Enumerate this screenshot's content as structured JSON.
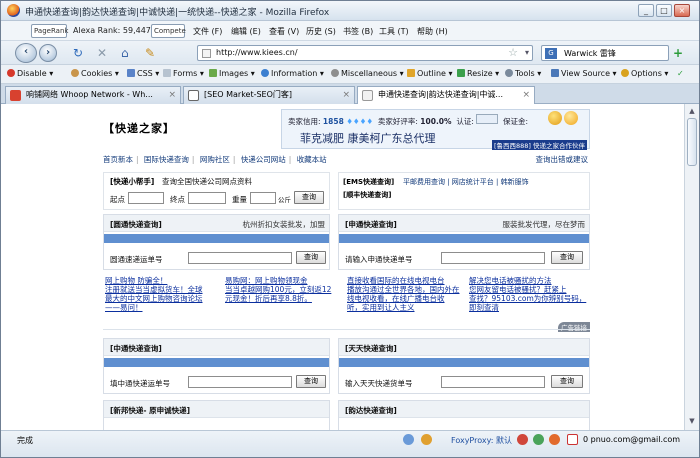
{
  "window": {
    "title": "申通快递查询|韵达快递查询|中诚快递|一统快递--快递之家 - Mozilla Firefox",
    "buttons": [
      "_",
      "□",
      "×"
    ]
  },
  "menubar": {
    "pagerank_label": "PageRank",
    "alexa": "Alexa Rank: 59,447",
    "compete_label": "Compete",
    "items": [
      "文件 (F)",
      "编辑 (E)",
      "查看 (V)",
      "历史 (S)",
      "书签 (B)",
      "工具 (T)",
      "帮助 (H)"
    ]
  },
  "navbar": {
    "url": "http://www.kiees.cn/",
    "search_text": "Warwick 雷锋",
    "search_engine": "G"
  },
  "devbar": {
    "items": [
      "Disable",
      "Cookies",
      "CSS",
      "Forms",
      "Images",
      "Information",
      "Miscellaneous",
      "Outline",
      "Resize",
      "Tools",
      "View Source",
      "Options"
    ]
  },
  "tabs": [
    {
      "label": "响铺网络 Whoop Network - Wh...",
      "active": false
    },
    {
      "label": "[SEO Market-SEO门客]",
      "active": false
    },
    {
      "label": "申通快递查询|韵达快递查询|中诚...",
      "active": true
    }
  ],
  "page": {
    "logo": "【快递之家】",
    "credit": {
      "seller_credit_label": "卖家信用:",
      "seller_credit_value": "1858",
      "positive_rate_label": "卖家好评率:",
      "positive_rate_value": "100.0%",
      "cert_label": "认证:",
      "deposit_label": "保证金:",
      "promo": "菲克减肥 康美柯广东总代理",
      "badge": "[鲁西西888] 快递之家合作伙伴"
    },
    "topnav": {
      "items": [
        "首页新本",
        "国际快递查询",
        "网购社区",
        "快递公司网站",
        "收藏本站"
      ],
      "right": "查询出错或建议"
    },
    "helper_panel": {
      "title": "[快递小帮手]",
      "subtitle": "查询全国快递公司网点资料",
      "start_label": "起点",
      "end_label": "终点",
      "weight_label": "重量",
      "weight_unit": "公斤",
      "button": "查询"
    },
    "ems_panel": {
      "title": "[EMS快递查询]",
      "links": "平邮费用查询 | 网店统计平台 | 韩新服饰",
      "sub": "[顺丰快递查询]"
    },
    "yuantong_panel": {
      "title": "[圆通快递查询]",
      "note": "杭州折扣女装批发，加盟",
      "field_label": "圆通速递运单号",
      "button": "查询"
    },
    "shentong_panel": {
      "title": "[申通快递查询]",
      "note": "服装批发代理，尽在梦而",
      "field_label": "请输入申通快递单号",
      "button": "查询"
    },
    "news": [
      {
        "lines": [
          "网上购物 防骗全！",
          "注册就送当当虚拟货车！全球",
          "最大的中文网上购物咨询论坛",
          "——易问！"
        ]
      },
      {
        "lines": [
          "易购网：网上购物领现金",
          "当当卓越网购100元，立刻返12",
          "元现金！折后再享8.8折。"
        ]
      },
      {
        "lines": [
          "直接收看国际的在线电视电台",
          "播放沟通过全世界各地，国内外在",
          "线电视收看，在线广播电台收",
          "听，实用到让人主义"
        ]
      },
      {
        "lines": [
          "解决您电话被骚扰的方法",
          "您网友留电话被骚扰？赶紧上",
          "查找？95103.com为你辨别号码，",
          "即刻查清"
        ]
      }
    ],
    "corner_tag": "广告链接",
    "zhongtong_panel": {
      "title": "[中通快递查询]",
      "field_label": "填中通快递运单号",
      "button": "查询"
    },
    "tiantian_panel": {
      "title": "[天天快递查询]",
      "field_label": "输入天天快递货单号",
      "button": "查询"
    },
    "xinbang_title": "[新邦快递- 原申诚快递]",
    "yunda_title": "[韵达快递查询]"
  },
  "statusbar": {
    "text": "完成",
    "foxyproxy": "FoxyProxy: 默认",
    "mail": "0 pnuo.com@gmail.com"
  }
}
